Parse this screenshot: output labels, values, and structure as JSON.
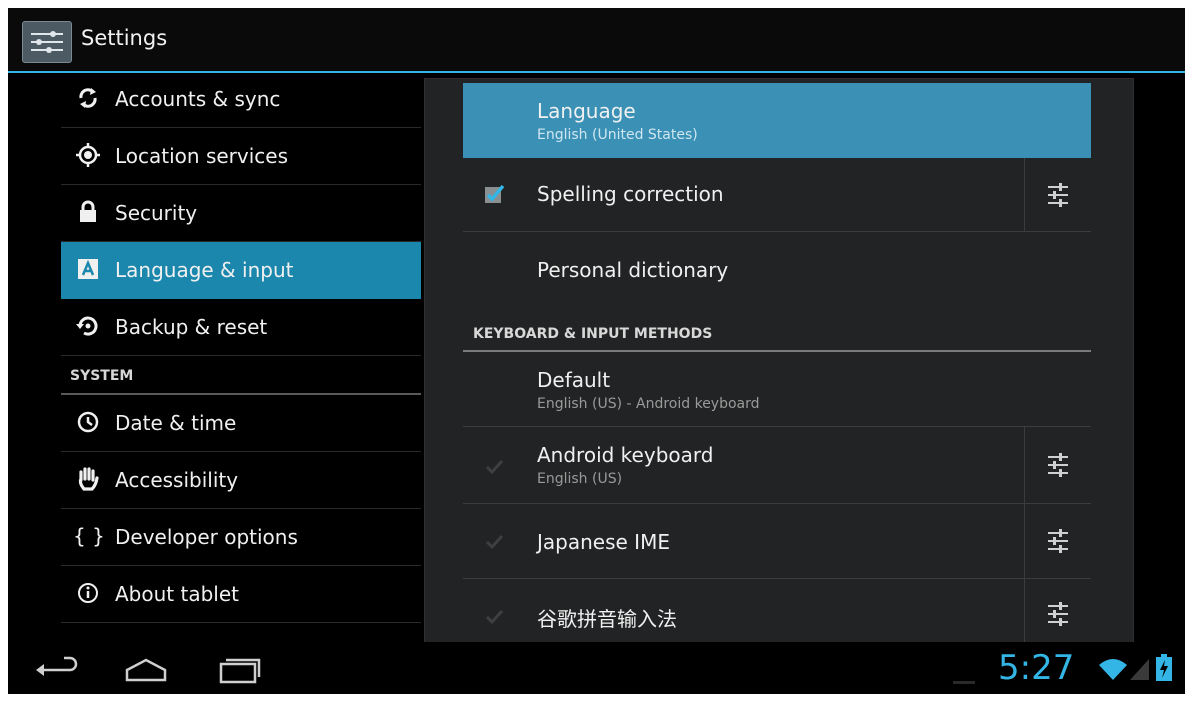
{
  "app": {
    "title": "Settings",
    "icon": "settings-sliders-icon"
  },
  "sidebar": {
    "items": [
      {
        "label": "Accounts & sync",
        "icon": "sync-icon"
      },
      {
        "label": "Location services",
        "icon": "location-icon"
      },
      {
        "label": "Security",
        "icon": "lock-icon"
      },
      {
        "label": "Language & input",
        "icon": "keyboard-a-icon",
        "selected": true
      },
      {
        "label": "Backup & reset",
        "icon": "backup-icon"
      }
    ],
    "section_system": "SYSTEM",
    "system_items": [
      {
        "label": "Date & time",
        "icon": "clock-icon"
      },
      {
        "label": "Accessibility",
        "icon": "hand-icon"
      },
      {
        "label": "Developer options",
        "icon": "braces-icon",
        "glyph": "{ }"
      },
      {
        "label": "About tablet",
        "icon": "info-icon"
      }
    ]
  },
  "detail": {
    "language": {
      "title": "Language",
      "sub": "English (United States)"
    },
    "spelling": {
      "title": "Spelling correction",
      "checked": true
    },
    "dictionary": {
      "title": "Personal dictionary"
    },
    "keyboard_header": "KEYBOARD & INPUT METHODS",
    "default": {
      "title": "Default",
      "sub": "English (US) - Android keyboard"
    },
    "android_keyboard": {
      "title": "Android keyboard",
      "sub": "English (US)",
      "checked": true,
      "disabled": true
    },
    "japanese_ime": {
      "title": "Japanese IME",
      "checked": true,
      "disabled": true
    },
    "pinyin": {
      "title": "谷歌拼音输入法",
      "checked": true,
      "disabled": true
    }
  },
  "status": {
    "time": "5:27"
  },
  "colors": {
    "accent": "#33b5e5",
    "selected_bg": "#1b87ad",
    "panel_bg": "#222324"
  }
}
